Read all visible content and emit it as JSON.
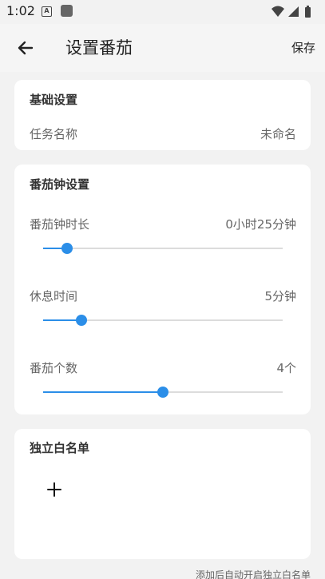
{
  "status_bar": {
    "time": "1:02",
    "notif_a": "A"
  },
  "header": {
    "title": "设置番茄",
    "save_label": "保存"
  },
  "basic_settings": {
    "title": "基础设置",
    "task_name_label": "任务名称",
    "task_name_value": "未命名"
  },
  "tomato_settings": {
    "title": "番茄钟设置",
    "sliders": [
      {
        "label": "番茄钟时长",
        "value": "0小时25分钟",
        "level": 0.1
      },
      {
        "label": "休息时间",
        "value": "5分钟",
        "level": 0.16
      },
      {
        "label": "番茄个数",
        "value": "4个",
        "level": 0.5
      }
    ]
  },
  "whitelist": {
    "title": "独立白名单",
    "hint": "添加后自动开启独立白名单"
  },
  "colors": {
    "accent": "#2b8ee8",
    "track": "#dcdcdc",
    "background": "#f2f2f2"
  },
  "icons": [
    "back-arrow-icon",
    "plus-icon",
    "wifi-icon",
    "signal-icon",
    "battery-icon"
  ]
}
